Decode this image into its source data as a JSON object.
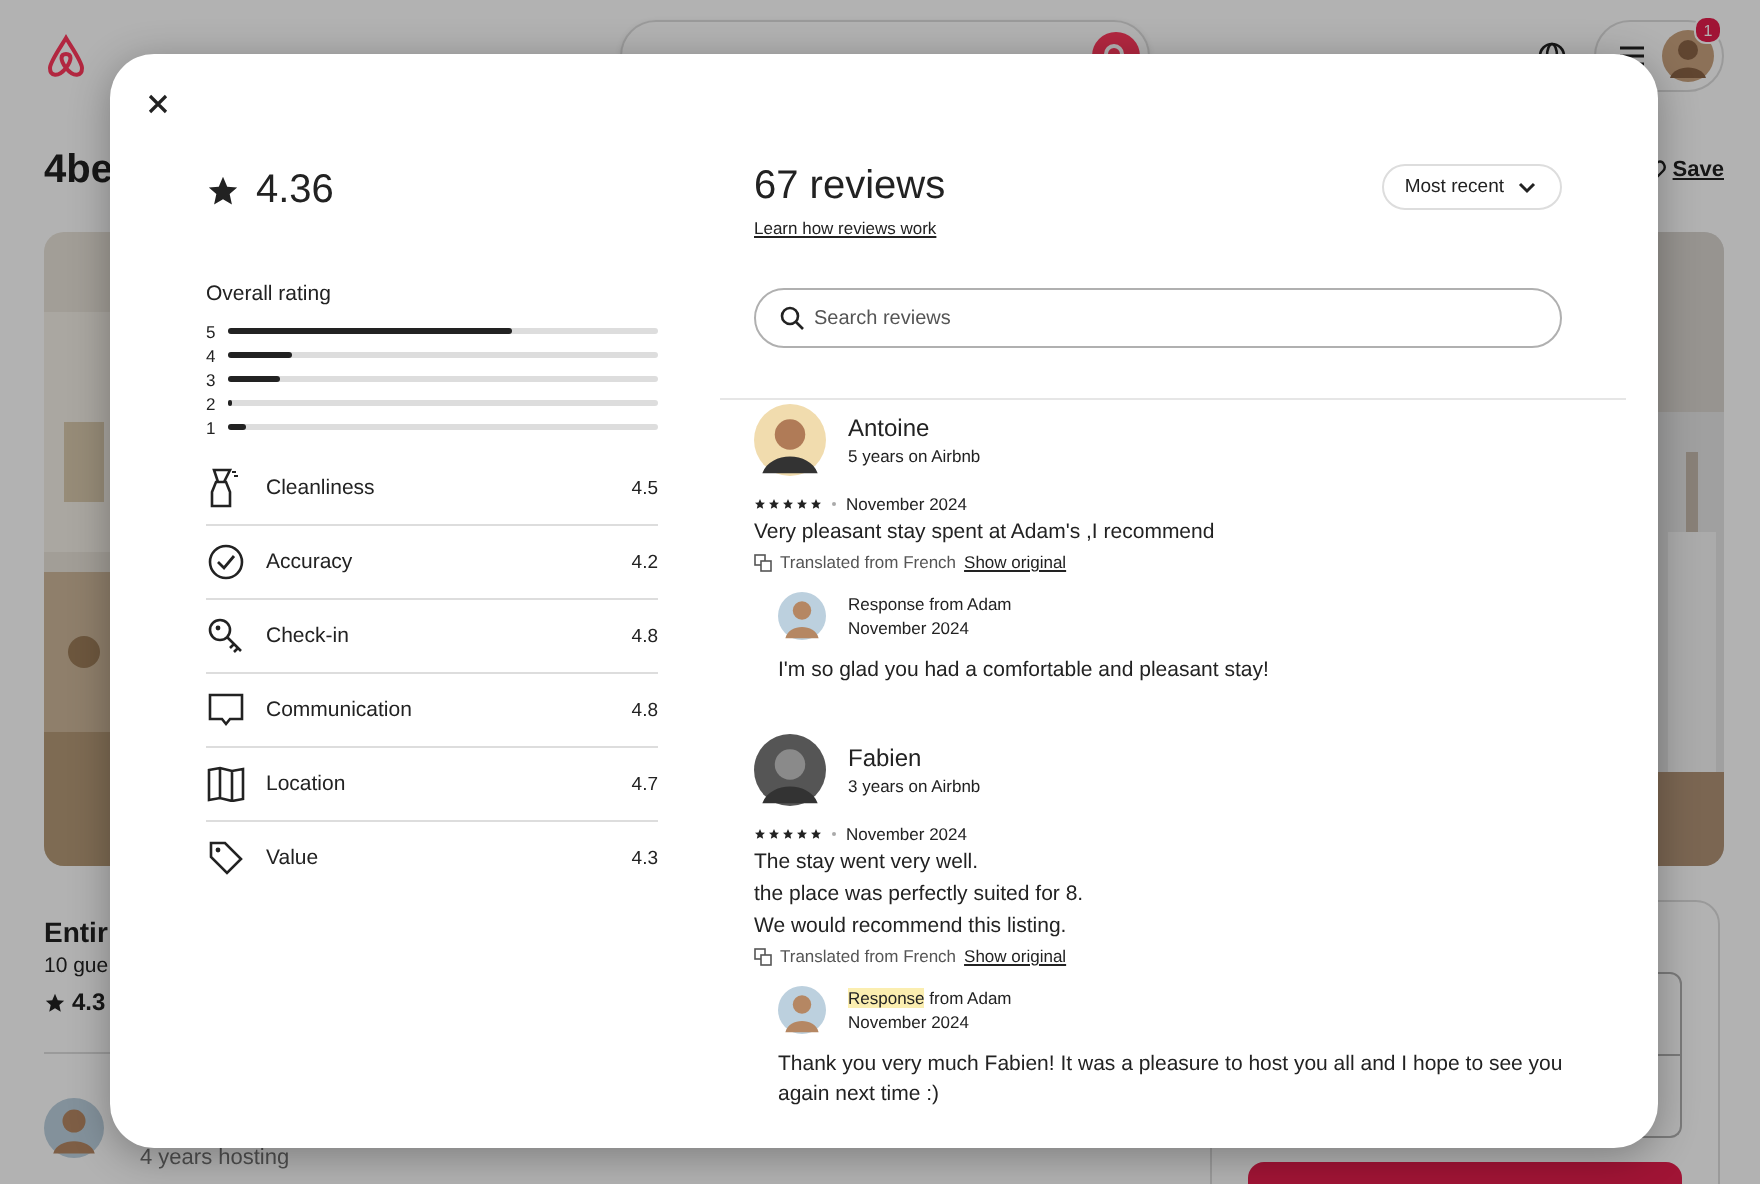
{
  "page": {
    "notification_count": "1",
    "title": "4be",
    "save": "Save",
    "listing_title": "Entir",
    "listing_guests": "10 gue",
    "listing_rating": "4.3",
    "host_meta": "4 years hosting"
  },
  "modal": {
    "rating": "4.36",
    "overall_label": "Overall rating",
    "distribution": [
      {
        "label": "5",
        "level": 0.66
      },
      {
        "label": "4",
        "level": 0.15
      },
      {
        "label": "3",
        "level": 0.12
      },
      {
        "label": "2",
        "level": 0.01
      },
      {
        "label": "1",
        "level": 0.04
      }
    ],
    "categories": [
      {
        "name": "Cleanliness",
        "score": "4.5"
      },
      {
        "name": "Accuracy",
        "score": "4.2"
      },
      {
        "name": "Check-in",
        "score": "4.8"
      },
      {
        "name": "Communication",
        "score": "4.8"
      },
      {
        "name": "Location",
        "score": "4.7"
      },
      {
        "name": "Value",
        "score": "4.3"
      }
    ],
    "reviews_title": "67 reviews",
    "learn_link": "Learn how reviews work",
    "sort": "Most recent",
    "search": {
      "placeholder": "Search reviews"
    },
    "reviews": [
      {
        "name": "Antoine",
        "tenure": "5 years on Airbnb",
        "stars": 5,
        "date": "November 2024",
        "lines": [
          "Very pleasant stay spent at Adam's ,I recommend"
        ],
        "translated": "Translated from French",
        "show_original": "Show original",
        "response": {
          "title_parts": [
            {
              "text": "Response",
              "highlighted": false
            },
            {
              "text": "from Adam",
              "highlighted": false
            }
          ],
          "date": "November 2024",
          "lines": [
            "I'm so glad you had a comfortable and pleasant stay!"
          ]
        }
      },
      {
        "name": "Fabien",
        "tenure": "3 years on Airbnb",
        "stars": 5,
        "date": "November 2024",
        "lines": [
          "The stay went very well.",
          "the place was perfectly suited for 8.",
          "We would recommend this listing."
        ],
        "translated": "Translated from French",
        "show_original": "Show original",
        "response": {
          "title_parts": [
            {
              "text": "Response",
              "highlighted": true
            },
            {
              "text": "from Adam",
              "highlighted": false
            }
          ],
          "date": "November 2024",
          "lines": [
            "Thank you very much Fabien! It was a pleasure to host you all and I hope to see you again next time :)"
          ]
        }
      }
    ]
  }
}
